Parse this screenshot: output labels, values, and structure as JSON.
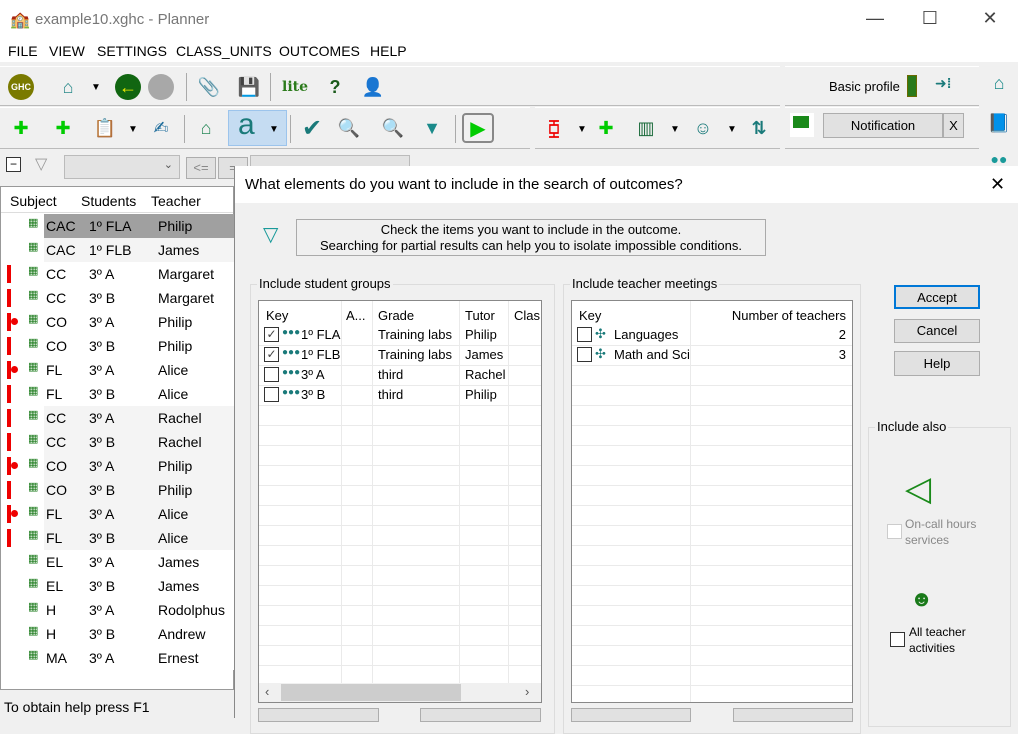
{
  "window": {
    "title": "example10.xghc - Planner",
    "minimize": "—",
    "maximize": "☐",
    "close": "✕"
  },
  "menu": [
    "FILE",
    "VIEW",
    "SETTINGS",
    "CLASS_UNITS",
    "OUTCOMES",
    "HELP"
  ],
  "toolbar": {
    "ghc_label": "GHC",
    "lite_label": "lite",
    "profile_label": "Basic profile",
    "notification_label": "Notification",
    "notification_close": "X",
    "font_button": "a",
    "compare_le": "<=",
    "compare_eq": "="
  },
  "list": {
    "headers": [
      "Subject",
      "Students",
      "Teacher"
    ],
    "rows": [
      {
        "subject": "CAC",
        "students": "1º FLA",
        "teacher": "Philip",
        "marker": "",
        "selected": true
      },
      {
        "subject": "CAC",
        "students": "1º FLB",
        "teacher": "James",
        "marker": ""
      },
      {
        "subject": "CC",
        "students": "3º A",
        "teacher": "Margaret",
        "marker": "start"
      },
      {
        "subject": "CC",
        "students": "3º B",
        "teacher": "Margaret",
        "marker": "mid"
      },
      {
        "subject": "CO",
        "students": "3º A",
        "teacher": "Philip",
        "marker": "dot"
      },
      {
        "subject": "CO",
        "students": "3º B",
        "teacher": "Philip",
        "marker": "mid"
      },
      {
        "subject": "FL",
        "students": "3º A",
        "teacher": "Alice",
        "marker": "dot"
      },
      {
        "subject": "FL",
        "students": "3º B",
        "teacher": "Alice",
        "marker": "end"
      },
      {
        "subject": "CC",
        "students": "3º A",
        "teacher": "Rachel",
        "marker": "start"
      },
      {
        "subject": "CC",
        "students": "3º B",
        "teacher": "Rachel",
        "marker": "mid"
      },
      {
        "subject": "CO",
        "students": "3º A",
        "teacher": "Philip",
        "marker": "dot"
      },
      {
        "subject": "CO",
        "students": "3º B",
        "teacher": "Philip",
        "marker": "mid"
      },
      {
        "subject": "FL",
        "students": "3º A",
        "teacher": "Alice",
        "marker": "dot"
      },
      {
        "subject": "FL",
        "students": "3º B",
        "teacher": "Alice",
        "marker": "end"
      },
      {
        "subject": "EL",
        "students": "3º A",
        "teacher": "James",
        "marker": ""
      },
      {
        "subject": "EL",
        "students": "3º B",
        "teacher": "James",
        "marker": ""
      },
      {
        "subject": "H",
        "students": "3º A",
        "teacher": "Rodolphus",
        "marker": ""
      },
      {
        "subject": "H",
        "students": "3º B",
        "teacher": "Andrew",
        "marker": ""
      },
      {
        "subject": "MA",
        "students": "3º A",
        "teacher": "Ernest",
        "marker": ""
      }
    ]
  },
  "status": "To obtain help press F1",
  "dialog": {
    "title": "What elements do you want to include in the search of outcomes?",
    "close": "✕",
    "message_line1": "Check the items you want to include in the outcome.",
    "message_line2": "Searching for partial results can help you to isolate impossible conditions.",
    "student_groups": {
      "label": "Include student groups",
      "headers": [
        "Key",
        "A...",
        "Grade",
        "Tutor",
        "Clas"
      ],
      "rows": [
        {
          "key": "1º FLA",
          "grade": "Training labs",
          "tutor": "Philip",
          "checked": true
        },
        {
          "key": "1º FLB",
          "grade": "Training labs",
          "tutor": "James",
          "checked": true
        },
        {
          "key": "3º A",
          "grade": "third",
          "tutor": "Rachel",
          "checked": false
        },
        {
          "key": "3º B",
          "grade": "third",
          "tutor": "Philip",
          "checked": false
        }
      ]
    },
    "teacher_meetings": {
      "label": "Include teacher meetings",
      "headers": [
        "Key",
        "Number of teachers"
      ],
      "rows": [
        {
          "key": "Languages",
          "count": "2",
          "checked": false
        },
        {
          "key": "Math and Sci",
          "count": "3",
          "checked": false
        }
      ]
    },
    "buttons": {
      "accept": "Accept",
      "cancel": "Cancel",
      "help": "Help"
    },
    "include_also": {
      "label": "Include also",
      "oncall": "On-call hours services",
      "oncall_enabled": false,
      "all_activities": "All teacher activities",
      "all_activities_checked": false
    }
  }
}
